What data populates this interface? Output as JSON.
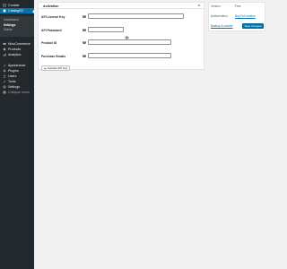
{
  "sidebar": {
    "items_top": [
      {
        "label": "Contact",
        "icon": "mail-icon"
      },
      {
        "label": "CatalogSC",
        "icon": "catalog-icon"
      }
    ],
    "submenu": [
      {
        "label": "Dashboard"
      },
      {
        "label": "Settings"
      },
      {
        "label": "Status"
      }
    ],
    "items_bottom": [
      {
        "label": "WooCommerce",
        "icon": "woocommerce-icon"
      },
      {
        "label": "Products",
        "icon": "products-icon"
      },
      {
        "label": "Analytics",
        "icon": "analytics-icon"
      },
      {
        "label": "Appearance",
        "icon": "appearance-icon"
      },
      {
        "label": "Plugins",
        "icon": "plugins-icon"
      },
      {
        "label": "Users",
        "icon": "users-icon"
      },
      {
        "label": "Tools",
        "icon": "tools-icon"
      },
      {
        "label": "Settings",
        "icon": "settings-icon"
      },
      {
        "label": "Collapse menu",
        "icon": "collapse-icon"
      }
    ]
  },
  "panel": {
    "title": "Activation",
    "fields": [
      {
        "label": "API License Key",
        "value": "",
        "placeholder": ""
      },
      {
        "label": "API Password",
        "value": "",
        "placeholder": ""
      },
      {
        "label": "Product ID",
        "value": "",
        "placeholder": ""
      },
      {
        "label": "Purchase Emails",
        "value": "",
        "placeholder": ""
      }
    ],
    "activate_button": "Activate API Key"
  },
  "status_box": {
    "version_label": "Version",
    "version_value": "Free",
    "auth_label": "Authorization",
    "auth_link": "Buy Full version",
    "support_link": "Backup & restore",
    "save_button": "Save changes"
  },
  "colors": {
    "sidebar_bg": "#23282d",
    "accent": "#0073aa",
    "page_bg": "#f1f1f1"
  }
}
